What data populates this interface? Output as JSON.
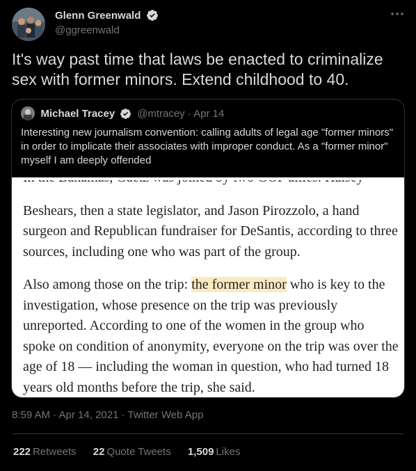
{
  "tweet": {
    "author": {
      "display_name": "Glenn Greenwald",
      "handle": "@ggreenwald",
      "verified": true
    },
    "text": "It's way past time that laws be enacted to criminalize sex with former minors. Extend childhood to 40.",
    "timestamp": "8:59 AM · Apr 14, 2021 · Twitter Web App",
    "stats": {
      "retweets": {
        "count": "222",
        "label": "Retweets"
      },
      "quote_tweets": {
        "count": "22",
        "label": "Quote Tweets"
      },
      "likes": {
        "count": "1,509",
        "label": "Likes"
      }
    }
  },
  "quote": {
    "display_name": "Michael Tracey",
    "meta": "@mtracey · Apr 14",
    "text": "Interesting new journalism convention: calling adults of legal age \"former minors\" in order to implicate their associates with improper conduct. As a \"former minor\" myself I am deeply offended",
    "article": {
      "p0": "In the Bahamas, Gaetz was joined by two GOP allies: Halsey",
      "p1": "Beshears, then a state legislator, and Jason Pirozzolo, a hand surgeon and Republican fundraiser for DeSantis, according to three sources, including one who was part of the group.",
      "p2_before": "Also among those on the trip: ",
      "p2_highlight": "the former minor",
      "p2_after": " who is key to the investigation, whose presence on the trip was previously unreported. According to one of the women in the group who spoke on condition of anonymity, everyone on the trip was over the age of 18 — including the woman in question, who had turned 18 years old months before the trip, she said."
    }
  },
  "colors": {
    "background": "#000000",
    "text": "#d9d9d9",
    "secondary": "#6e767d",
    "border": "#2f3336",
    "highlight": "#fbeac0"
  }
}
